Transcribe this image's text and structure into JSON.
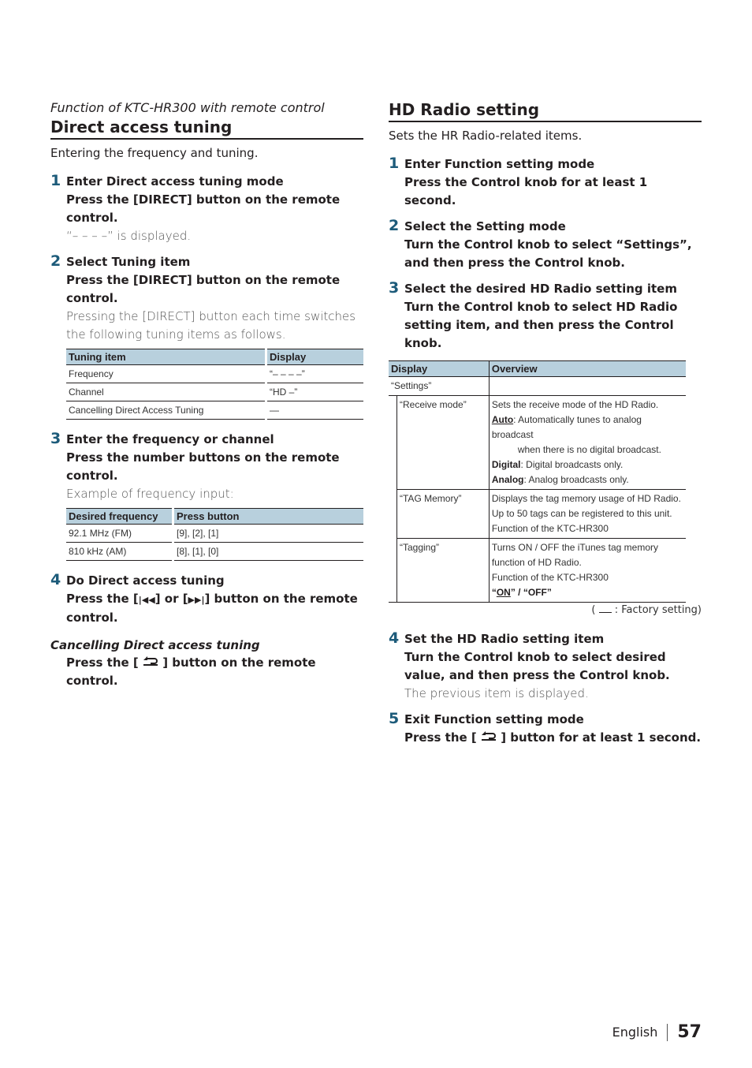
{
  "left": {
    "subtitle": "Function of KTC-HR300 with remote control",
    "title": "Direct access tuning",
    "intro": "Entering the frequency and tuning.",
    "steps": [
      {
        "num": "1",
        "title": "Enter Direct access tuning mode",
        "action": "Press the [DIRECT] button on the remote control.",
        "note": "“– – – –” is displayed."
      },
      {
        "num": "2",
        "title": "Select Tuning item",
        "action": "Press the [DIRECT] button on the remote control.",
        "note": "Pressing the [DIRECT] button each time switches the following tuning items as follows."
      },
      {
        "num": "3",
        "title": "Enter the frequency or channel",
        "action": "Press the number buttons on the remote control.",
        "note": "Example of frequency input:"
      },
      {
        "num": "4",
        "title": "Do Direct access tuning",
        "action": "Press the [⏮] or [⏭] button on the remote control."
      }
    ],
    "tuning_table": {
      "headers": [
        "Tuning item",
        "Display"
      ],
      "rows": [
        [
          "Frequency",
          "“– – – –”"
        ],
        [
          "Channel",
          "“HD –”"
        ],
        [
          "Cancelling Direct Access Tuning",
          "—"
        ]
      ]
    },
    "freq_table": {
      "headers": [
        "Desired frequency",
        "Press button"
      ],
      "rows": [
        [
          "92.1 MHz (FM)",
          "[9], [2], [1]"
        ],
        [
          "810 kHz (AM)",
          "[8], [1], [0]"
        ]
      ]
    },
    "step4_prefix": "Press the [",
    "step4_mid": "] or [",
    "step4_suffix": "] button on the remote control.",
    "cancel_heading": "Cancelling Direct access tuning",
    "cancel_prefix": "Press the [",
    "cancel_suffix": "] button on the remote control."
  },
  "right": {
    "title": "HD Radio setting",
    "intro": "Sets the HR Radio-related items.",
    "steps": [
      {
        "num": "1",
        "title": "Enter Function setting mode",
        "action": "Press the Control knob for at least 1 second."
      },
      {
        "num": "2",
        "title": "Select the Setting mode",
        "action": "Turn the Control knob to select “Settings”, and then press the Control knob."
      },
      {
        "num": "3",
        "title": "Select the desired HD Radio setting item",
        "action": "Turn the Control knob to select HD Radio setting item, and then press the Control knob."
      },
      {
        "num": "4",
        "title": "Set the HD Radio setting item",
        "action": "Turn the Control knob to select desired value, and then press the Control knob.",
        "note": "The previous item is displayed."
      },
      {
        "num": "5",
        "title": "Exit Function setting mode"
      }
    ],
    "step5_prefix": "Press the [",
    "step5_suffix": "] button for at least 1 second.",
    "hd_table": {
      "headers": [
        "Display",
        "Overview"
      ],
      "group": "“Settings”",
      "rows": {
        "receive": {
          "display": "“Receive mode”",
          "line1": "Sets the receive mode of the HD Radio.",
          "auto_label": "Auto",
          "auto_text": ": Automatically tunes to analog broadcast",
          "auto_text2": "when there is no digital broadcast.",
          "digital_label": "Digital",
          "digital_text": ": Digital broadcasts only.",
          "analog_label": "Analog",
          "analog_text": ": Analog broadcasts only."
        },
        "tag_memory": {
          "display": "“TAG Memory”",
          "line1": "Displays the tag memory usage of HD Radio.",
          "line2": "Up to 50 tags can be registered to this unit.",
          "line3": "Function of the KTC-HR300"
        },
        "tagging": {
          "display": "“Tagging”",
          "line1": "Turns ON / OFF the iTunes tag memory",
          "line2": "function of HD Radio.",
          "line3": "Function of the KTC-HR300",
          "opt_open": "“",
          "opt_on": "ON",
          "opt_rest": "” / “OFF”"
        }
      }
    },
    "factory_note_open": "( ",
    "factory_note_text": " : Factory setting)"
  },
  "footer": {
    "language": "English",
    "page": "57"
  }
}
